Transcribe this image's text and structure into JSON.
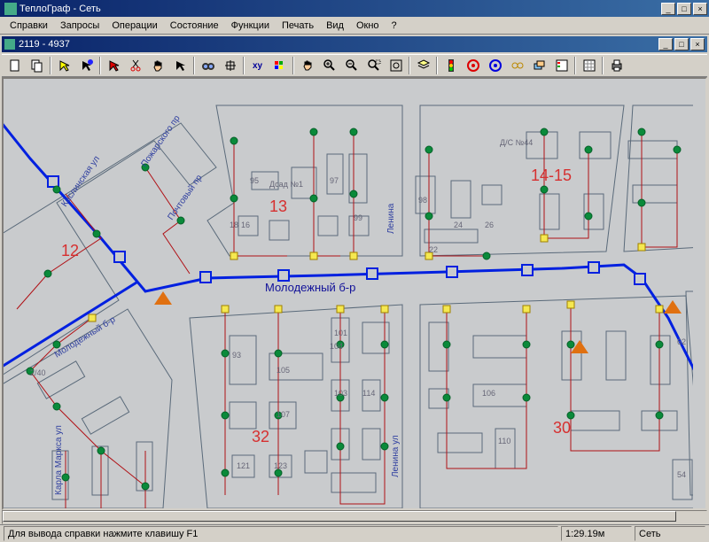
{
  "app": {
    "title": "ТеплоГраф - Сеть"
  },
  "menus": [
    "Справки",
    "Запросы",
    "Операции",
    "Состояние",
    "Функции",
    "Печать",
    "Вид",
    "Окно",
    "?"
  ],
  "subwindow": {
    "title": "2119 - 4937"
  },
  "toolbar": {
    "items": [
      "file",
      "copy",
      "arrow-yellow",
      "arrow-blue",
      "arrow-red",
      "cut",
      "hand",
      "pointer",
      "binoculars",
      "nav",
      "xy",
      "palette",
      "pan",
      "zoom-in",
      "zoom-out",
      "zoom-region",
      "fit",
      "layers",
      "traffic-light",
      "target-red",
      "target-blue",
      "chain",
      "layers2",
      "legend",
      "grid",
      "print"
    ]
  },
  "status": {
    "help": "Для вывода справки нажмите клавишу F1",
    "coord": "1:29.19м",
    "mode": "Сеть"
  },
  "zones": {
    "z12": "12",
    "z13": "13",
    "z14": "14-15",
    "z30": "30",
    "z32": "32"
  },
  "streets": {
    "main": "Молодежный б-р",
    "molod2": "Молодежный б-р",
    "lenina": "Ленина",
    "lenina2": "Ленина ул",
    "marx": "Карла Маркса ул",
    "kaslin": "Каслинская ул",
    "pozhar": "Пожарского пр",
    "pocht": "Почтовый пр"
  },
  "labels": {
    "dsad": "Дсад №1",
    "ds": "Д/С №44"
  },
  "addr": {
    "a95": "95",
    "a16": "16",
    "a97": "97",
    "a98": "98",
    "a99": "99",
    "a24": "24",
    "a26": "26",
    "a22": "22",
    "a2_40": "2/40",
    "a93": "93",
    "a18": "18",
    "a105": "105",
    "a104": "104",
    "a107": "107",
    "a106": "106",
    "a110": "110",
    "a101": "101",
    "a103": "103",
    "a114": "114",
    "a121": "121",
    "a123": "123",
    "a54": "54",
    "a62": "62"
  },
  "colors": {
    "zone": "#d63030",
    "street": "#111199",
    "pipe_red": "#b01015",
    "pipe_blue": "#0020e0",
    "node_green": "#0a8a3a",
    "node_yellow": "#f5e850",
    "map_bg": "#c9cbcd"
  }
}
